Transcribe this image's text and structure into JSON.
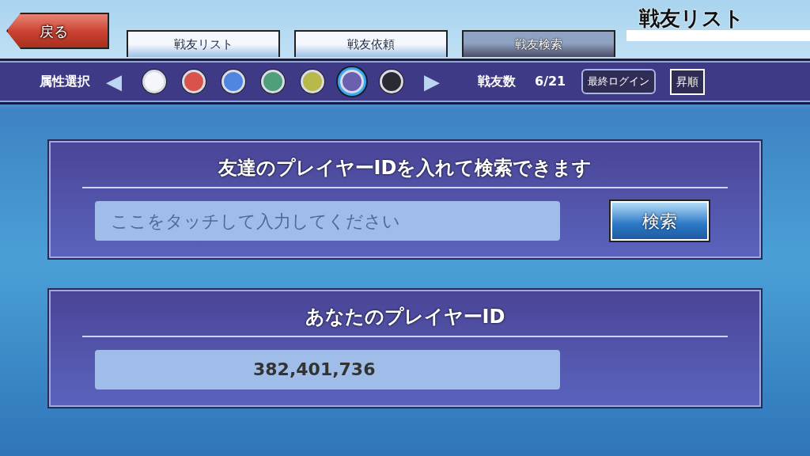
{
  "back_button": "戻る",
  "tabs": [
    {
      "label": "戦友リスト",
      "selected": false
    },
    {
      "label": "戦友依頼",
      "selected": false
    },
    {
      "label": "戦友検索",
      "selected": true
    }
  ],
  "screen_title": "戦友リスト",
  "filter_bar": {
    "label": "属性選択",
    "prev": "◀",
    "next": "▶",
    "attributes": [
      {
        "color": "#f4f6fa",
        "selected": false
      },
      {
        "color": "#d9534b",
        "selected": false
      },
      {
        "color": "#4f86e0",
        "selected": false
      },
      {
        "color": "#4fa07a",
        "selected": false
      },
      {
        "color": "#b9b84a",
        "selected": false
      },
      {
        "color": "#6b5fb0",
        "selected": true
      },
      {
        "color": "#2a2a34",
        "selected": false
      }
    ],
    "count_label": "戦友数",
    "count": "6/21",
    "sort_key": "最終ログイン",
    "sort_order": "昇順"
  },
  "search_panel": {
    "title": "友達のプレイヤーIDを入れて検索できます",
    "placeholder": "ここをタッチして入力してください",
    "button": "検索"
  },
  "id_panel": {
    "title": "あなたのプレイヤーID",
    "value": "382,401,736"
  }
}
